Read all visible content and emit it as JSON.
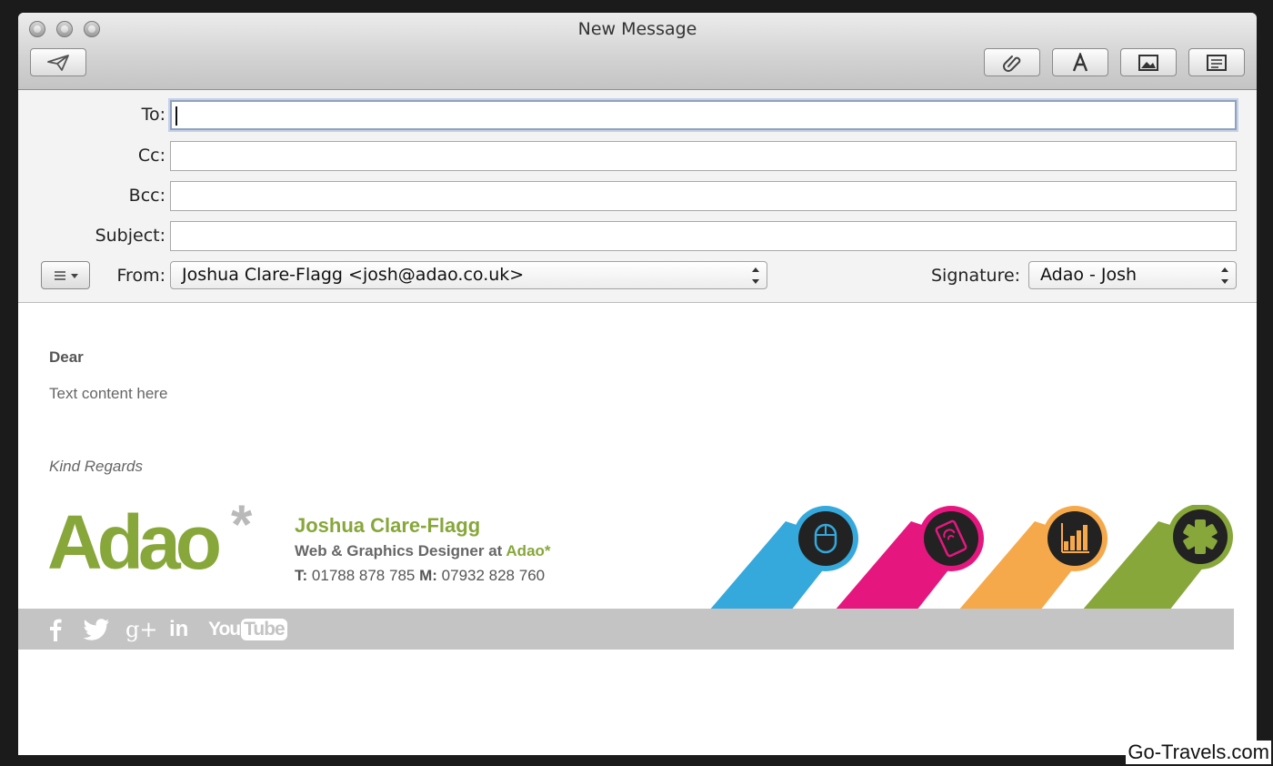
{
  "window": {
    "title": "New Message"
  },
  "toolbar": {
    "send": "send-icon",
    "attach": "paperclip-icon",
    "format": "font-icon",
    "photo": "photo-browser-icon",
    "stationery": "stationery-icon"
  },
  "fields": {
    "to_label": "To:",
    "to_value": "",
    "cc_label": "Cc:",
    "cc_value": "",
    "bcc_label": "Bcc:",
    "bcc_value": "",
    "subject_label": "Subject:",
    "subject_value": "",
    "from_label": "From:",
    "from_value": "Joshua Clare-Flagg <josh@adao.co.uk>",
    "signature_label": "Signature:",
    "signature_value": "Adao - Josh"
  },
  "body": {
    "greeting": "Dear",
    "content": "Text content here",
    "closing": "Kind Regards"
  },
  "signature": {
    "logo": "Adao",
    "logo_star": "*",
    "name": "Joshua Clare-Flagg",
    "role_prefix": "Web & Graphics Designer at ",
    "role_company": "Adao*",
    "phone_t_label": "T:",
    "phone_t": "01788 878 785",
    "phone_m_label": "M:",
    "phone_m": "07932 828 760",
    "colors": [
      "#35a8dc",
      "#e5177f",
      "#f6a94a",
      "#87a73a"
    ],
    "icons": [
      "mouse-icon",
      "mobile-icon",
      "chart-icon",
      "asterisk-icon"
    ],
    "social": [
      "facebook-icon",
      "twitter-icon",
      "google-plus-icon",
      "linkedin-icon",
      "youtube-icon"
    ],
    "social_text": {
      "gplus": "g+",
      "linkedin": "in",
      "you": "You",
      "tube": "Tube"
    }
  },
  "watermark": "Go-Travels.com"
}
